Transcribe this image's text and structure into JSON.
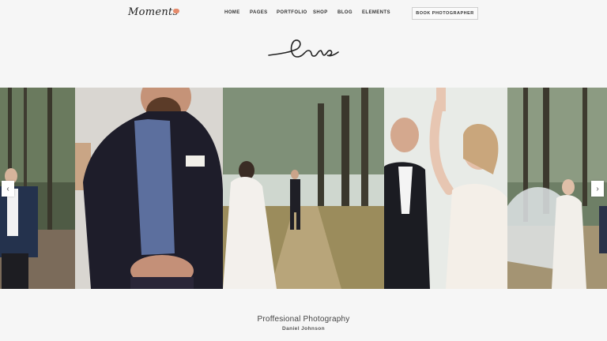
{
  "brand": {
    "logo_text": "Moments"
  },
  "nav": {
    "items": [
      "HOME",
      "PAGES",
      "PORTFOLIO",
      "SHOP",
      "BLOG",
      "ELEMENTS"
    ],
    "cta_label": "BOOK PHOTOGRAPHER"
  },
  "hero": {
    "script_title": "Love"
  },
  "gallery": {
    "slides": [
      "forest-portrait-groom",
      "bearded-man-in-suit",
      "couple-in-forest-path",
      "laughing-couple",
      "bride-walking-in-forest"
    ],
    "prev_arrow": "‹",
    "next_arrow": "›"
  },
  "caption": {
    "title": "Proffesional Photography",
    "author": "Daniel Johnson"
  },
  "colors": {
    "accent": "#e58b6b",
    "background": "#f6f6f6"
  }
}
